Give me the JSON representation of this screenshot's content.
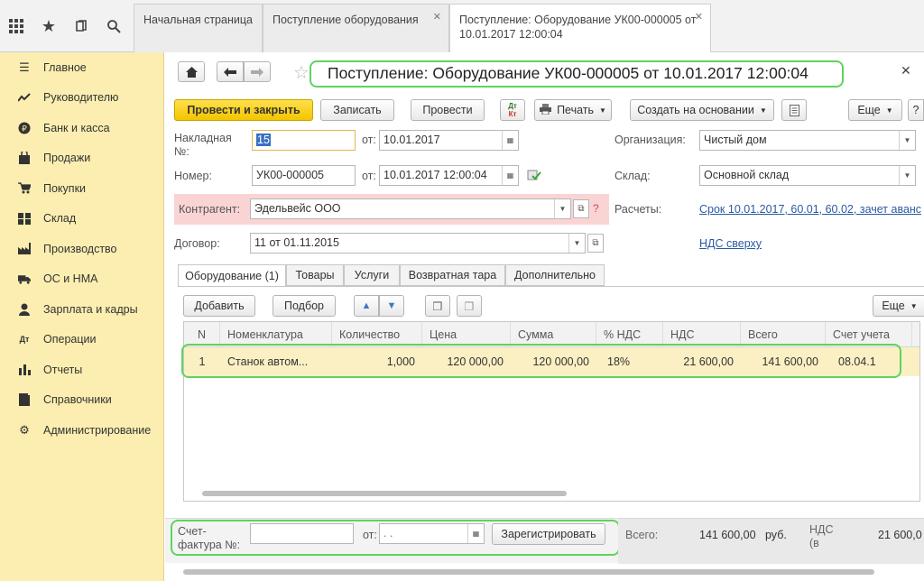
{
  "topbar": {
    "tabs": [
      {
        "label": "Начальная страница"
      },
      {
        "label": "Поступление оборудования"
      },
      {
        "label": "Поступление: Оборудование УК00-000005 от 10.01.2017 12:00:04"
      }
    ]
  },
  "sidebar": {
    "items": [
      {
        "label": "Главное",
        "icon": "menu-icon"
      },
      {
        "label": "Руководителю",
        "icon": "chart-icon"
      },
      {
        "label": "Банк и касса",
        "icon": "ruble-icon"
      },
      {
        "label": "Продажи",
        "icon": "bag-icon"
      },
      {
        "label": "Покупки",
        "icon": "cart-icon"
      },
      {
        "label": "Склад",
        "icon": "warehouse-icon"
      },
      {
        "label": "Производство",
        "icon": "factory-icon"
      },
      {
        "label": "ОС и НМА",
        "icon": "truck-icon"
      },
      {
        "label": "Зарплата и кадры",
        "icon": "person-icon"
      },
      {
        "label": "Операции",
        "icon": "operations-icon"
      },
      {
        "label": "Отчеты",
        "icon": "bars-icon"
      },
      {
        "label": "Справочники",
        "icon": "book-icon"
      },
      {
        "label": "Администрирование",
        "icon": "gear-icon"
      }
    ]
  },
  "doc": {
    "title": "Поступление: Оборудование УК00-000005 от 10.01.2017 12:00:04",
    "toolbar": {
      "post_close": "Провести и закрыть",
      "save": "Записать",
      "post": "Провести",
      "dtkt": "Дт Кт",
      "print": "Печать",
      "create_based": "Создать на основании",
      "more": "Еще"
    },
    "invoice_label": "Накладная №:",
    "invoice_value": "15",
    "from_label": "от:",
    "invoice_date": "10.01.2017",
    "number_label": "Номер:",
    "number_value": "УК00-000005",
    "number_date": "10.01.2017 12:00:04",
    "org_label": "Организация:",
    "org_value": "Чистый дом",
    "warehouse_label": "Склад:",
    "warehouse_value": "Основной склад",
    "contractor_label": "Контрагент:",
    "contractor_value": "Эдельвейс ООО",
    "settlements_label": "Расчеты:",
    "settlements_link": "Срок 10.01.2017, 60.01, 60.02, зачет аванс",
    "contract_label": "Договор:",
    "contract_value": "11 от 01.11.2015",
    "vat_link": "НДС сверху",
    "help": "?"
  },
  "subtabs": [
    {
      "label": "Оборудование (1)"
    },
    {
      "label": "Товары"
    },
    {
      "label": "Услуги"
    },
    {
      "label": "Возвратная тара"
    },
    {
      "label": "Дополнительно"
    }
  ],
  "table_toolbar": {
    "add": "Добавить",
    "pick": "Подбор",
    "more": "Еще"
  },
  "table": {
    "headers": [
      "N",
      "Номенклатура",
      "Количество",
      "Цена",
      "Сумма",
      "% НДС",
      "НДС",
      "Всего",
      "Счет учета"
    ],
    "rows": [
      [
        "1",
        "Станок автом...",
        "1,000",
        "120 000,00",
        "120 000,00",
        "18%",
        "21 600,00",
        "141 600,00",
        "08.04.1"
      ]
    ]
  },
  "footer": {
    "sf_label": "Счет-фактура №:",
    "from_label": "от:",
    "date_placeholder": "  .  .",
    "register": "Зарегистрировать",
    "total_label": "Всего:",
    "total_value": "141 600,00",
    "currency": "руб.",
    "vat_label": "НДС (в",
    "vat_value": "21 600,0"
  }
}
